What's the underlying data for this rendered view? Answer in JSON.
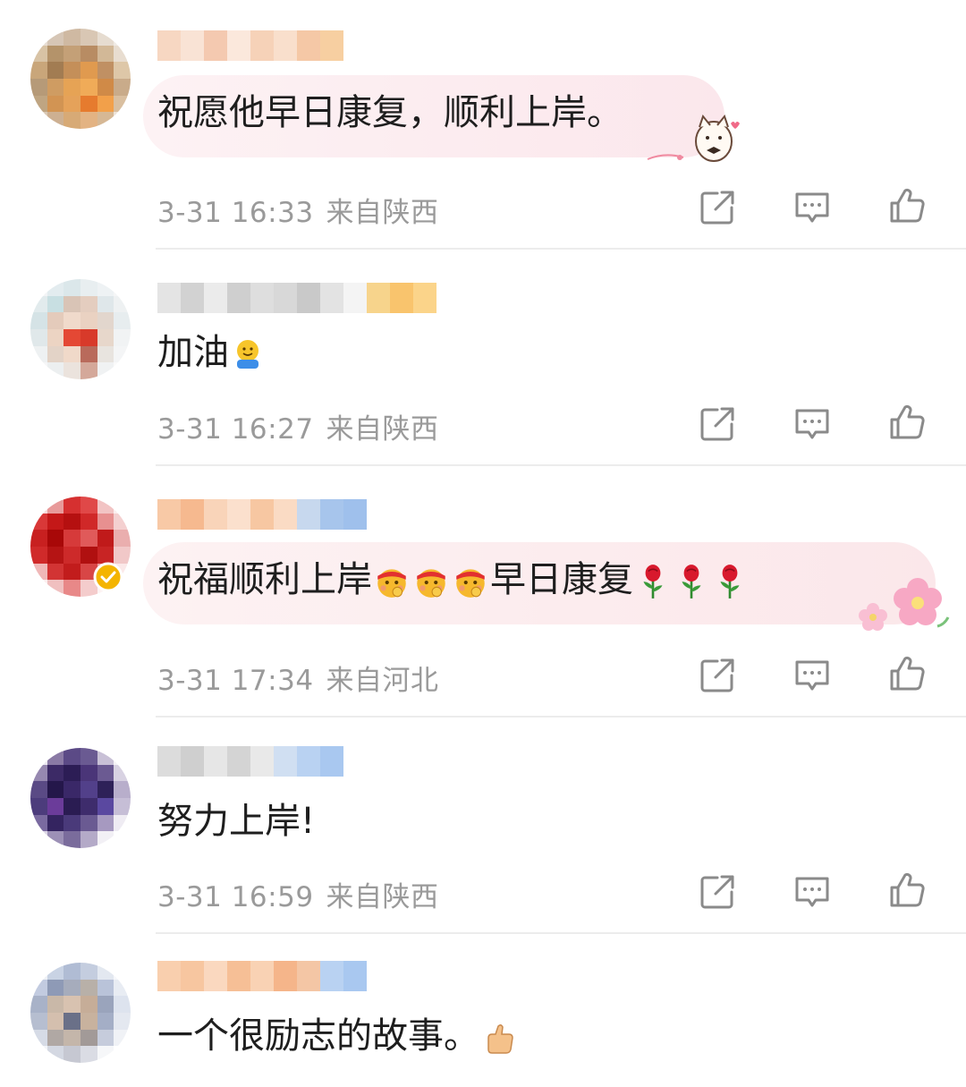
{
  "comments": [
    {
      "text": "祝愿他早日康复，顺利上岸。",
      "time": "3-31 16:33",
      "location": "来自陕西"
    },
    {
      "text": "加油",
      "time": "3-31 16:27",
      "location": "来自陕西"
    },
    {
      "text_a": "祝福顺利上岸",
      "text_b": "早日康复",
      "time": "3-31 17:34",
      "location": "来自河北"
    },
    {
      "text": "努力上岸!",
      "time": "3-31 16:59",
      "location": "来自陕西"
    },
    {
      "text": "一个很励志的故事。"
    }
  ],
  "icons": {
    "share": "share-icon",
    "reply": "comment-icon",
    "like": "thumbs-up-icon"
  },
  "colors": {
    "meta": "#9a9a9a",
    "divider": "#ececec",
    "icon": "#8a8a8a"
  }
}
